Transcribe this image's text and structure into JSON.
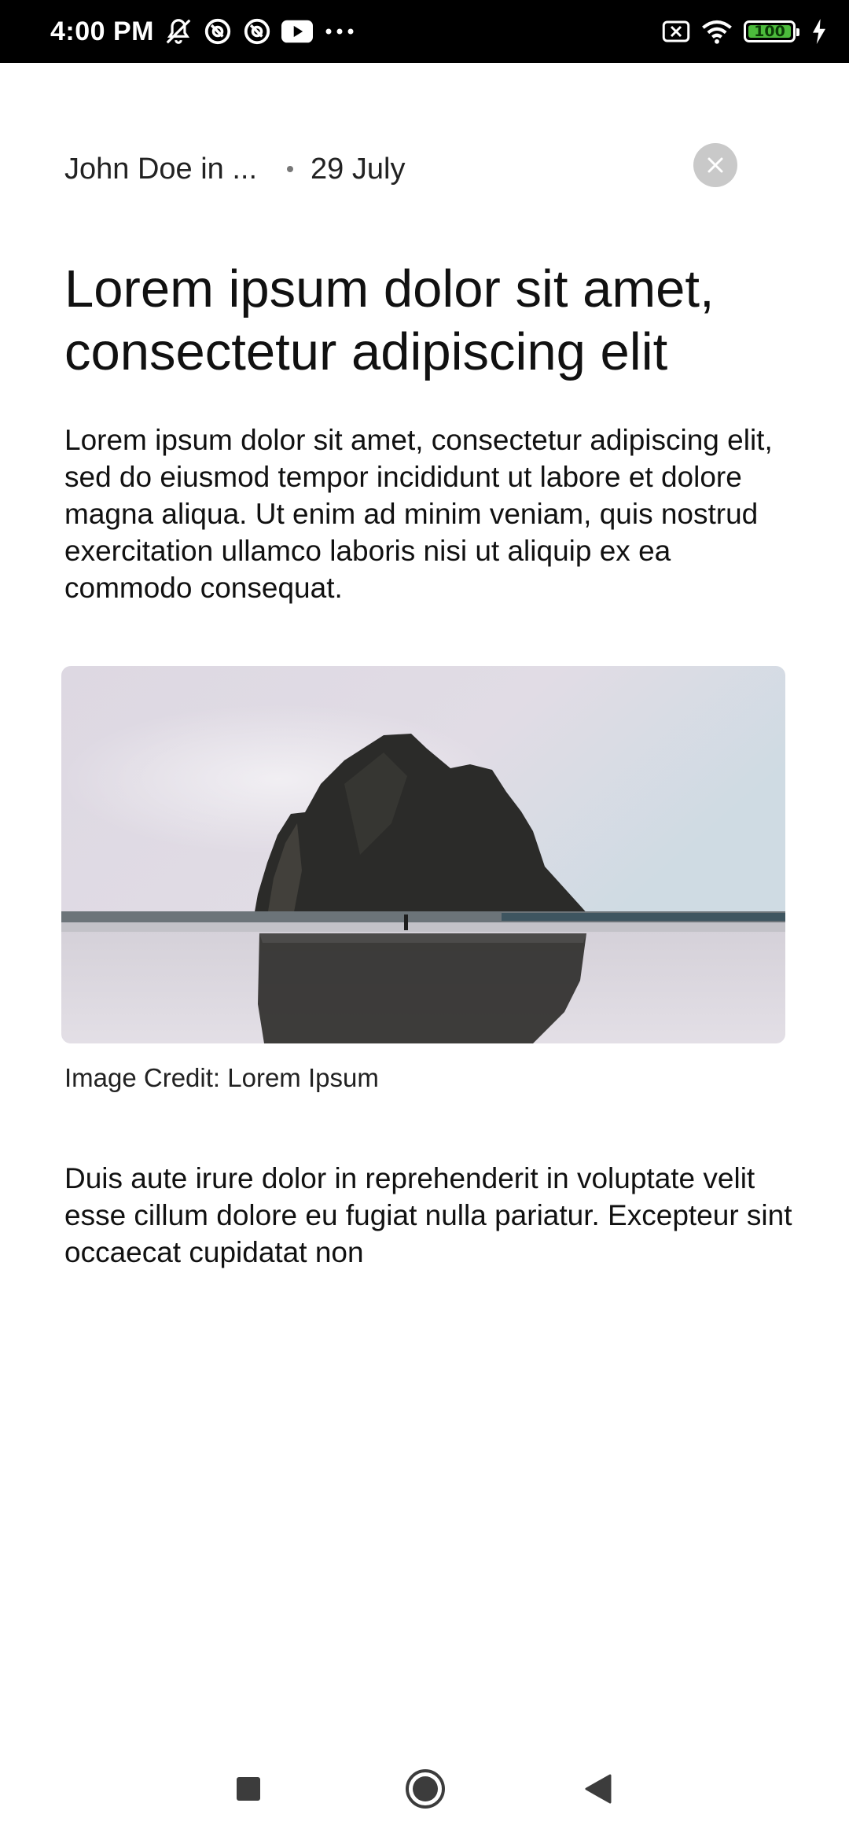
{
  "status_bar": {
    "time": "4:00 PM",
    "left_icons": [
      "notifications-muted-icon",
      "assistant-icon",
      "assistant-icon",
      "youtube-icon",
      "more-dots-icon"
    ],
    "right_icons": [
      "data-off-icon",
      "wifi-icon",
      "battery-icon",
      "charging-icon"
    ],
    "battery_level": "100"
  },
  "article": {
    "author": "John Doe in ...",
    "date": "29 July",
    "title": "Lorem ipsum dolor sit amet, consectetur adipiscing elit",
    "intro": "Lorem ipsum dolor sit amet, consectetur adipiscing elit, sed do eiusmod tempor incididunt ut labore et dolore magna aliqua. Ut enim ad minim veniam, quis nostrud exercitation ullamco laboris nisi ut aliquip ex ea commodo consequat.",
    "image_caption": "Image Credit: Lorem Ipsum",
    "body": "Duis aute irure dolor in reprehenderit in voluptate velit esse cillum dolore eu fugiat nulla pariatur. Excepteur sint occaecat cupidatat non"
  },
  "actions": {
    "close_icon": "close-icon"
  },
  "nav_bar": {
    "items": [
      "recents-icon",
      "home-icon",
      "back-icon"
    ]
  },
  "colors": {
    "status_bar_bg": "#000000",
    "battery_green": "#4cbb3c",
    "close_button_bg": "#c9c9c9",
    "text": "#111111"
  }
}
